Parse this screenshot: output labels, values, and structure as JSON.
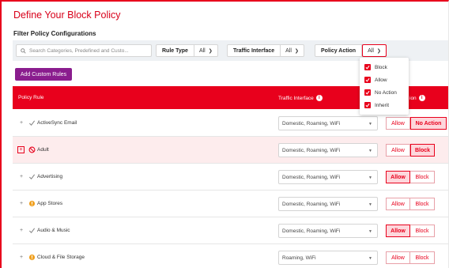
{
  "page": {
    "title": "Define Your Block Policy",
    "subtitle": "Filter Policy Configurations"
  },
  "filters": {
    "search_placeholder": "Search Categories, Predefined and Custo...",
    "rule_type": {
      "label": "Rule Type",
      "value": "All"
    },
    "traffic_interface": {
      "label": "Traffic Interface",
      "value": "All"
    },
    "policy_action": {
      "label": "Policy Action",
      "value": "All"
    }
  },
  "add_custom_rules_label": "Add Custom Rules",
  "table_headers": {
    "policy_rule": "Policy Rule",
    "traffic_interface": "Traffic Interface",
    "action": "ion"
  },
  "policy_action_options": [
    {
      "label": "Block",
      "checked": true
    },
    {
      "label": "Allow",
      "checked": true
    },
    {
      "label": "No Action",
      "checked": true
    },
    {
      "label": "Inherit",
      "checked": true
    }
  ],
  "rows": [
    {
      "name": "ActiveSync Email",
      "icon": "check-icon",
      "traffic": "Domestic, Roaming, WiFi",
      "actions": [
        "Allow",
        "No Action"
      ],
      "selected": "No Action"
    },
    {
      "name": "Adult",
      "icon": "blocked-icon",
      "traffic": "Domestic, Roaming, WiFi",
      "actions": [
        "Allow",
        "Block"
      ],
      "selected": "Block"
    },
    {
      "name": "Advertising",
      "icon": "check-icon",
      "traffic": "Domestic, Roaming, WiFi",
      "actions": [
        "Allow",
        "Block"
      ],
      "selected": "Allow"
    },
    {
      "name": "App Stores",
      "icon": "warning-icon",
      "traffic": "Domestic, Roaming, WiFi",
      "actions": [
        "Allow",
        "Block"
      ],
      "selected": ""
    },
    {
      "name": "Audio & Music",
      "icon": "check-icon",
      "traffic": "Domestic, Roaming, WiFi",
      "actions": [
        "Allow",
        "Block"
      ],
      "selected": "Allow"
    },
    {
      "name": "Cloud & File Storage",
      "icon": "warning-icon",
      "traffic": "Roaming, WiFi",
      "actions": [
        "Allow",
        "Block"
      ],
      "selected": ""
    }
  ],
  "colors": {
    "accent": "#e8001c",
    "purple_button": "#8a1d8e",
    "warning": "#f0a020",
    "check": "#2a9d4a"
  }
}
